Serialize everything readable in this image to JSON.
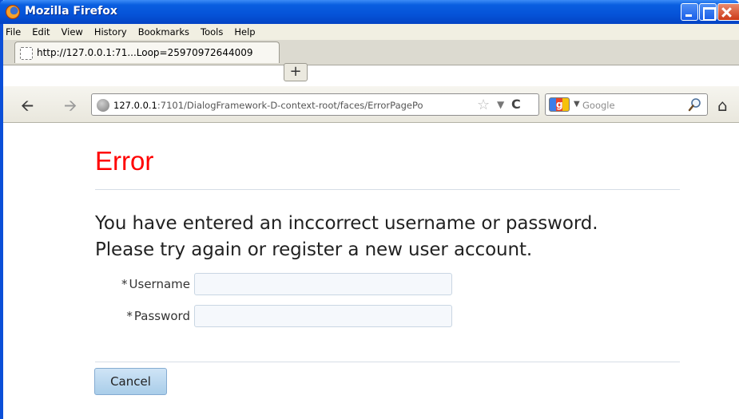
{
  "window": {
    "title": "Mozilla Firefox"
  },
  "menubar": {
    "items": [
      "File",
      "Edit",
      "View",
      "History",
      "Bookmarks",
      "Tools",
      "Help"
    ]
  },
  "tabs": [
    {
      "label": "http://127.0.0.1:71...Loop=25970972644009"
    }
  ],
  "newtab_label": "+",
  "navbar": {
    "url_host": "127.0.0.1",
    "url_rest": ":7101/DialogFramework-D-context-root/faces/ErrorPagePo",
    "search_engine": "Google",
    "search_placeholder": "Google"
  },
  "page": {
    "title": "Error",
    "message_line1": "You have entered an inccorrect username or password.",
    "message_line2": "Please try again or register a new user account.",
    "fields": {
      "username_label": "Username",
      "username_value": "",
      "password_label": "Password",
      "password_value": "",
      "required_marker": "*"
    },
    "cancel_label": "Cancel"
  },
  "colors": {
    "title_red": "#ff0000",
    "titlebar_blue": "#0553d8",
    "button_blue": "#a9cde9"
  }
}
